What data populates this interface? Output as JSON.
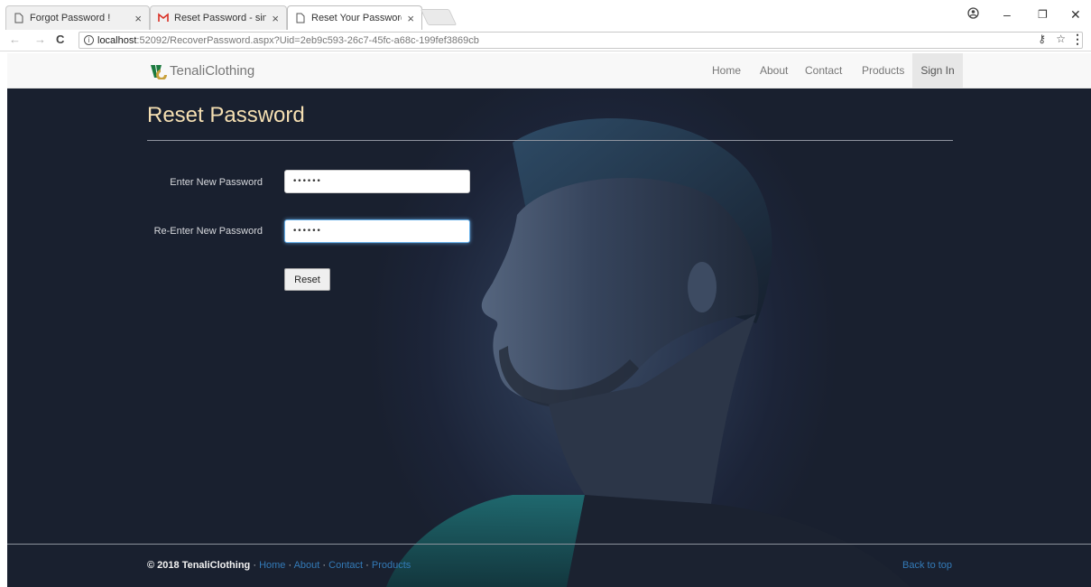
{
  "browser": {
    "tabs": [
      {
        "title": "Forgot Password !",
        "icon": "page-icon",
        "active": false
      },
      {
        "title": "Reset Password - singha",
        "icon": "gmail-icon",
        "active": false
      },
      {
        "title": "Reset Your Password",
        "icon": "page-icon",
        "active": true
      }
    ],
    "address": {
      "host": "localhost",
      "path": ":52092/RecoverPassword.aspx?Uid=2eb9c593-26c7-45fc-a68c-199fef3869cb"
    }
  },
  "site": {
    "brand": "TenaliClothing",
    "nav": {
      "home": "Home",
      "about": "About",
      "contact": "Contact",
      "products": "Products",
      "signin": "Sign In"
    }
  },
  "main": {
    "title": "Reset Password",
    "fields": {
      "new_password": {
        "label": "Enter New Password",
        "value": "••••••"
      },
      "reenter_password": {
        "label": "Re-Enter New Password",
        "value": "••••••"
      }
    },
    "reset_label": "Reset"
  },
  "footer": {
    "copyright": "© 2018 TenaliClothing",
    "sep": "·",
    "links": {
      "home": "Home",
      "about": "About",
      "contact": "Contact",
      "products": "Products"
    },
    "back_to_top": "Back to top"
  },
  "colors": {
    "title": "#f5dfb2",
    "link": "#337ab7",
    "hero_bg": "#1c2438",
    "brand_green": "#1b7a3f"
  }
}
